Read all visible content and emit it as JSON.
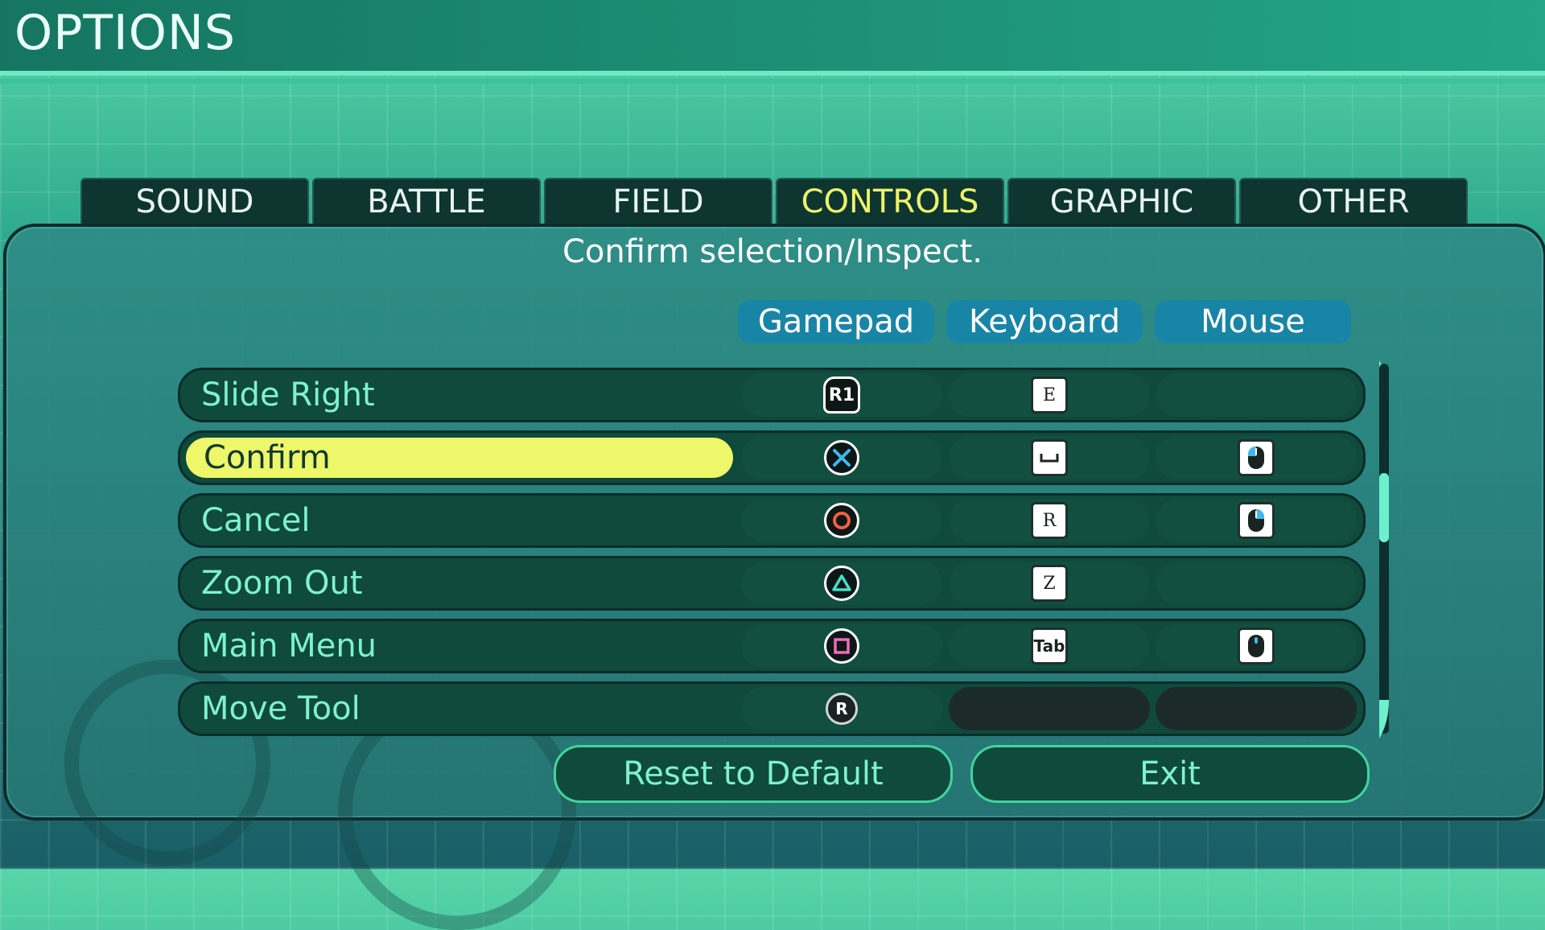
{
  "header": {
    "title": "OPTIONS"
  },
  "tabs": [
    {
      "label": "SOUND",
      "active": false
    },
    {
      "label": "BATTLE",
      "active": false
    },
    {
      "label": "FIELD",
      "active": false
    },
    {
      "label": "CONTROLS",
      "active": true
    },
    {
      "label": "GRAPHIC",
      "active": false
    },
    {
      "label": "OTHER",
      "active": false
    }
  ],
  "description": "Confirm selection/Inspect.",
  "columns": {
    "gamepad": "Gamepad",
    "keyboard": "Keyboard",
    "mouse": "Mouse"
  },
  "rows": [
    {
      "label": "Slide Right",
      "gamepad": "R1",
      "keyboard": "E",
      "mouse": ""
    },
    {
      "label": "Confirm",
      "gamepad": "cross-icon",
      "keyboard": "space-key-icon",
      "mouse": "mouse-left-click-icon"
    },
    {
      "label": "Cancel",
      "gamepad": "circle-icon",
      "keyboard": "R",
      "mouse": "mouse-right-click-icon"
    },
    {
      "label": "Zoom Out",
      "gamepad": "triangle-icon",
      "keyboard": "Z",
      "mouse": ""
    },
    {
      "label": "Main Menu",
      "gamepad": "square-icon",
      "keyboard": "Tab",
      "mouse": "mouse-middle-click-icon"
    },
    {
      "label": "Move Tool",
      "gamepad": "R",
      "keyboard": "",
      "mouse": ""
    }
  ],
  "buttons": {
    "reset": "Reset to Default",
    "exit": "Exit"
  },
  "colors": {
    "selected_row": "#eef66a",
    "active_tab": "#ecf36a",
    "column_header": "#1985a6",
    "cross": "#3fb8ee",
    "circle": "#f06045",
    "triangle": "#42e0c8",
    "square": "#f06ab8"
  }
}
